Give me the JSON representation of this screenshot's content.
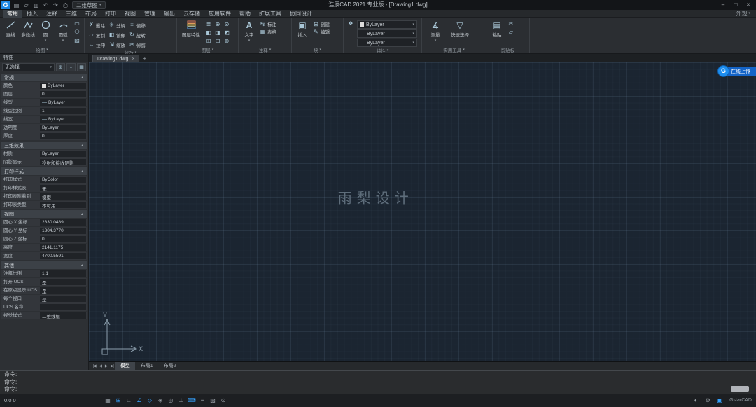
{
  "ui": {
    "caret": "▾",
    "collapse": "▲",
    "close": "×",
    "plus": "+",
    "line": "—"
  },
  "colors": {
    "accent": "#2e9bff",
    "canvas_bg": "#1b2531",
    "ribbon_bg": "#2b2e32",
    "titlebar_bg": "#131518",
    "badge_blue": "#1464c8"
  },
  "window": {
    "logo": "G",
    "qat": [
      {
        "name": "new-icon",
        "glyph": "▤"
      },
      {
        "name": "open-icon",
        "glyph": "▱"
      },
      {
        "name": "save-icon",
        "glyph": "▥"
      },
      {
        "name": "undo-icon",
        "glyph": "↶"
      },
      {
        "name": "redo-icon",
        "glyph": "↷"
      },
      {
        "name": "print-icon",
        "glyph": "⎙"
      }
    ],
    "workspace": "二维草图",
    "title": "浩辰CAD 2021 专业版 - [Drawing1.dwg]",
    "controls": [
      {
        "name": "minimize-icon",
        "glyph": "–"
      },
      {
        "name": "maximize-icon",
        "glyph": "□"
      },
      {
        "name": "close-icon",
        "glyph": "×"
      }
    ]
  },
  "menu": {
    "items": [
      "常用",
      "插入",
      "注释",
      "三维",
      "布局",
      "打印",
      "视图",
      "管理",
      "输出",
      "云存储",
      "应用软件",
      "帮助",
      "扩展工具",
      "协同设计"
    ],
    "right": "外观"
  },
  "ribbon": {
    "groups": {
      "draw": {
        "label": "绘图",
        "big": [
          {
            "label": "直线"
          },
          {
            "label": "多段线"
          },
          {
            "label": "圆"
          },
          {
            "label": "圆弧"
          }
        ],
        "small": [
          {
            "name": "rectangle-icon",
            "glyph": "▭"
          },
          {
            "name": "polygon-icon",
            "glyph": "⎔"
          },
          {
            "name": "hatch-icon",
            "glyph": "▨"
          }
        ]
      },
      "modify": {
        "label": "修改",
        "buttons": [
          {
            "label": "删除",
            "glyph": "✗"
          },
          {
            "label": "复制",
            "glyph": "▱"
          },
          {
            "label": "拉伸",
            "glyph": "↔"
          },
          {
            "label": "分解",
            "glyph": "✳"
          },
          {
            "label": "镜像",
            "glyph": "◧"
          },
          {
            "label": "缩放",
            "glyph": "⇲"
          },
          {
            "label": "偏移",
            "glyph": "≡"
          },
          {
            "label": "旋转",
            "glyph": "↻"
          },
          {
            "label": "修剪",
            "glyph": "✂"
          }
        ]
      },
      "layers": {
        "label": "图层",
        "main": "图层特性",
        "small": [
          "≣",
          "⊕",
          "⊝",
          "◧",
          "◨",
          "◩",
          "⊞",
          "⊟",
          "⊜"
        ]
      },
      "annotate": {
        "label": "注释",
        "main": "文字",
        "main_glyph": "A",
        "buttons": [
          {
            "label": "标注",
            "glyph": "↹"
          },
          {
            "label": "表格",
            "glyph": "▦"
          }
        ]
      },
      "block": {
        "label": "块",
        "main": "插入",
        "main_glyph": "▣",
        "buttons": [
          {
            "label": "创建",
            "glyph": "⊞"
          },
          {
            "label": "编辑",
            "glyph": "✎"
          }
        ]
      },
      "props": {
        "label": "特性",
        "match_glyph": "❖",
        "dropdowns": [
          {
            "name": "color",
            "value": "ByLayer"
          },
          {
            "name": "linetype",
            "value": "ByLayer"
          },
          {
            "name": "lineweight",
            "value": "ByLayer"
          }
        ]
      },
      "utils": {
        "label": "实用工具",
        "buttons": [
          {
            "label": "测量",
            "glyph": "∡"
          },
          {
            "label": "快速选择",
            "glyph": "▽"
          }
        ]
      },
      "clipboard": {
        "label": "剪贴板",
        "main": "粘贴",
        "main_glyph": "▤",
        "small": [
          "✂",
          "▱"
        ]
      }
    }
  },
  "doc_tabs": {
    "active": "Drawing1.dwg"
  },
  "properties": {
    "header": "特性",
    "selector": "无选择",
    "selector_icons": [
      {
        "name": "pick-add-icon",
        "glyph": "⊕"
      },
      {
        "name": "select-objects-icon",
        "glyph": "⌖"
      },
      {
        "name": "quick-select-icon",
        "glyph": "▦"
      }
    ],
    "sections": [
      {
        "title": "常规",
        "rows": [
          {
            "label": "颜色",
            "value": "ByLayer"
          },
          {
            "label": "图层",
            "value": "0"
          },
          {
            "label": "线型",
            "value": "ByLayer"
          },
          {
            "label": "线型比例",
            "value": "1"
          },
          {
            "label": "线宽",
            "value": "ByLayer"
          },
          {
            "label": "透明度",
            "value": "ByLayer"
          },
          {
            "label": "厚度",
            "value": "0"
          }
        ]
      },
      {
        "title": "三维效果",
        "rows": [
          {
            "label": "材质",
            "value": "ByLayer"
          },
          {
            "label": "阴影显示",
            "value": "投射和接收阴影"
          }
        ]
      },
      {
        "title": "打印样式",
        "rows": [
          {
            "label": "打印样式",
            "value": "ByColor"
          },
          {
            "label": "打印样式表",
            "value": "无"
          },
          {
            "label": "打印表附着到",
            "value": "模型"
          },
          {
            "label": "打印表类型",
            "value": "不可用"
          }
        ]
      },
      {
        "title": "视图",
        "rows": [
          {
            "label": "圆心 X 坐标",
            "value": "2830.0489"
          },
          {
            "label": "圆心 Y 坐标",
            "value": "1304.3770"
          },
          {
            "label": "圆心 Z 坐标",
            "value": "0"
          },
          {
            "label": "高度",
            "value": "2141.1175"
          },
          {
            "label": "宽度",
            "value": "4700.5591"
          }
        ]
      },
      {
        "title": "其他",
        "rows": [
          {
            "label": "注释比例",
            "value": "1:1"
          },
          {
            "label": "打开 UCS",
            "value": "是"
          },
          {
            "label": "在原点显示 UCS",
            "value": "是"
          },
          {
            "label": "每个视口",
            "value": "是"
          },
          {
            "label": "UCS 名称",
            "value": ""
          },
          {
            "label": "视觉样式",
            "value": "二维线框"
          }
        ]
      }
    ]
  },
  "canvas": {
    "watermark": "雨梨设计",
    "ucs": {
      "x": "X",
      "y": "Y"
    },
    "badge": {
      "logo": "G",
      "text": "在线上传"
    }
  },
  "layout_bar": {
    "nav": [
      "|◀",
      "◀",
      "▶",
      "▶|"
    ],
    "tabs": [
      "模型",
      "布局1",
      "布局2"
    ]
  },
  "command": {
    "lines": [
      "命令:",
      "命令:",
      "命令:"
    ]
  },
  "status": {
    "coords": "0.0 0",
    "left_icons": [
      {
        "name": "snap-icon",
        "glyph": "▦"
      },
      {
        "name": "grid-icon",
        "glyph": "⊞"
      },
      {
        "name": "ortho-icon",
        "glyph": "∟"
      },
      {
        "name": "polar-tracking-icon",
        "glyph": "∠"
      },
      {
        "name": "object-snap-icon",
        "glyph": "◇"
      },
      {
        "name": "object-snap-3d-icon",
        "glyph": "◈"
      },
      {
        "name": "object-tracking-icon",
        "glyph": "◎"
      },
      {
        "name": "dynamic-ucs-icon",
        "glyph": "⊥"
      },
      {
        "name": "dynamic-input-icon",
        "glyph": "⌨"
      },
      {
        "name": "lineweight-icon",
        "glyph": "≡"
      },
      {
        "name": "transparency-icon",
        "glyph": "▨"
      },
      {
        "name": "selection-cycling-icon",
        "glyph": "⊙"
      }
    ],
    "right_icons": [
      {
        "name": "isolate-objects-icon",
        "glyph": "◐"
      },
      {
        "name": "gear-icon",
        "glyph": "⚙"
      },
      {
        "name": "fullscreen-icon",
        "glyph": "▣"
      }
    ],
    "brand": "GstarCAD"
  }
}
